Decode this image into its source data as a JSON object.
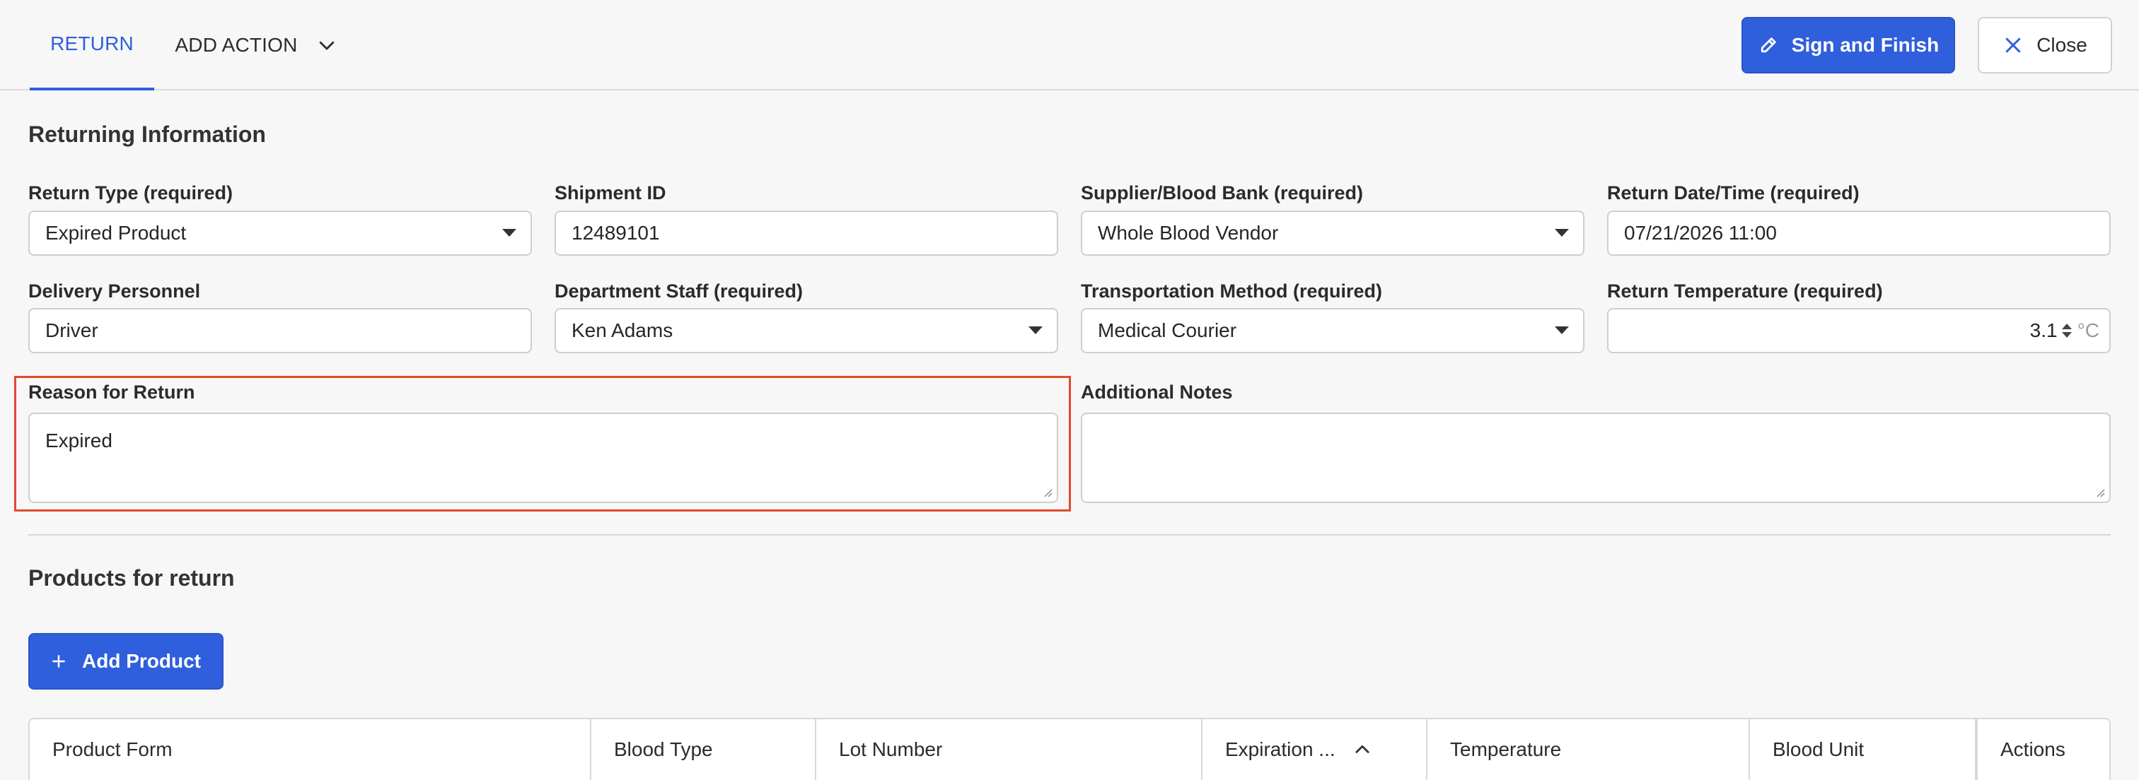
{
  "topbar": {
    "tabs": [
      {
        "label": "RETURN",
        "active": true
      },
      {
        "label": "ADD ACTION",
        "active": false
      }
    ],
    "sign_label": "Sign and Finish",
    "close_label": "Close"
  },
  "returning": {
    "title": "Returning Information",
    "fields": {
      "return_type": {
        "label": "Return Type (required)",
        "value": "Expired Product"
      },
      "shipment_id": {
        "label": "Shipment ID",
        "value": "12489101"
      },
      "supplier": {
        "label": "Supplier/Blood Bank (required)",
        "value": "Whole Blood Vendor"
      },
      "return_datetime": {
        "label": "Return Date/Time (required)",
        "value": "07/21/2026 11:00"
      },
      "delivery_personnel": {
        "label": "Delivery Personnel",
        "value": "Driver"
      },
      "department_staff": {
        "label": "Department Staff (required)",
        "value": "Ken Adams"
      },
      "transport_method": {
        "label": "Transportation Method (required)",
        "value": "Medical Courier"
      },
      "return_temperature": {
        "label": "Return Temperature (required)",
        "value": "3.1",
        "unit": "°C"
      },
      "reason": {
        "label": "Reason for Return",
        "value": "Expired"
      },
      "notes": {
        "label": "Additional Notes",
        "value": ""
      }
    }
  },
  "products": {
    "title": "Products for return",
    "add_label": "Add Product",
    "columns": [
      "Product Form",
      "Blood Type",
      "Lot Number",
      "Expiration ...",
      "Temperature",
      "Blood Unit",
      "Actions"
    ]
  },
  "colors": {
    "accent": "#2f5fdc",
    "highlight": "#e2492f"
  }
}
